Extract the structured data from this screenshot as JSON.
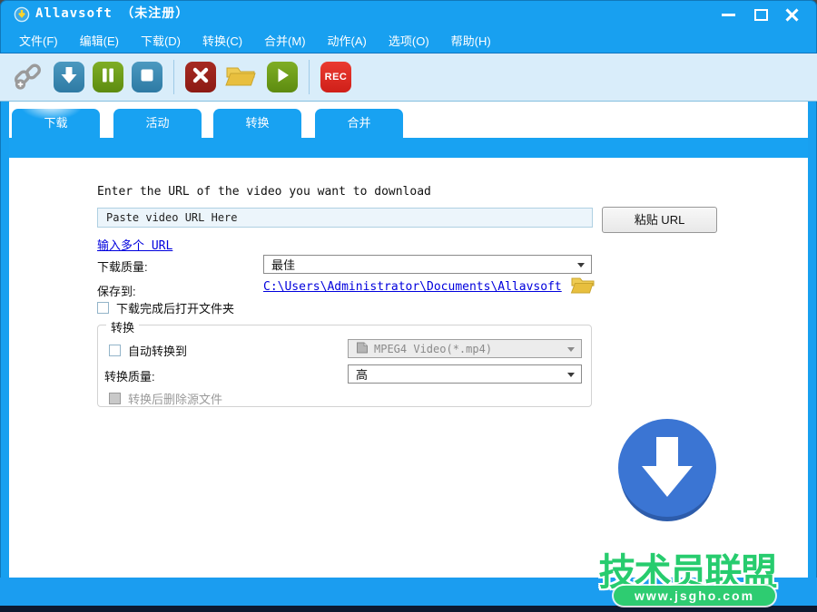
{
  "window": {
    "title": "Allavsoft （未注册）"
  },
  "menu": {
    "items": [
      "文件(F)",
      "编辑(E)",
      "下载(D)",
      "转换(C)",
      "合并(M)",
      "动作(A)",
      "选项(O)",
      "帮助(H)"
    ]
  },
  "toolbar": {
    "rec_label": "REC"
  },
  "tabs": [
    {
      "label": "下载",
      "active": true
    },
    {
      "label": "活动",
      "active": false
    },
    {
      "label": "转换",
      "active": false
    },
    {
      "label": "合并",
      "active": false
    }
  ],
  "form": {
    "url_prompt": "Enter the URL of the video you want to download",
    "url_value": "Paste video URL Here",
    "paste_button": "粘贴 URL",
    "multi_url_link": "输入多个 URL",
    "download_quality_label": "下载质量:",
    "download_quality_value": "最佳",
    "save_to_label": "保存到:",
    "save_path": "C:\\Users\\Administrator\\Documents\\Allavsoft",
    "open_folder_label": "下载完成后打开文件夹",
    "convert": {
      "group_title": "转换",
      "auto_convert_label": "自动转换到",
      "format_value": "MPEG4 Video(*.mp4)",
      "quality_label": "转换质量:",
      "quality_value": "高",
      "delete_source_label": "转换后删除源文件"
    }
  },
  "watermark": {
    "title": "技术员联盟",
    "url": "www.jsgho.com"
  },
  "colors": {
    "titlebar_blue": "#18a0f0",
    "toolbar_bg": "#d9edfa",
    "tab_blue": "#18a2f2",
    "steel_button": "#3584ad",
    "green_button": "#6b9a18",
    "dark_red_button": "#9b1d1b",
    "rec_red": "#e02723",
    "circle_blue": "#3b75d3",
    "watermark_green": "#2ecc71",
    "link_blue": "#0000dd"
  }
}
